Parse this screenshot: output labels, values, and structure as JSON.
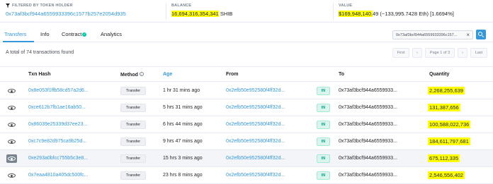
{
  "topbar": {
    "filter_label": "FILTERED BY TOKEN HOLDER",
    "filter_address": "0x73af3bcf944a6559933396c1577b257e2054d935",
    "balance_label": "BALANCE",
    "balance_amount": "16,694,316,354,341",
    "balance_token": "SHIB",
    "value_label": "VALUE",
    "value_usd": "$169,948,140.",
    "value_rest": "49 (~133,995.7428 Eth) [1.6694%]"
  },
  "tabs": [
    {
      "label": "Transfers"
    },
    {
      "label": "Info"
    },
    {
      "label": "Contract"
    },
    {
      "label": "Analytics"
    }
  ],
  "search": {
    "value": "0x73af3bcf944a6559933396c157...",
    "close": "×"
  },
  "summary": "A total of 74 transactions found",
  "pagination": {
    "first": "First",
    "prev": "‹",
    "page": "Page 1 of 3",
    "next": "›",
    "last": "Last"
  },
  "table": {
    "headers": {
      "txn_hash": "Txn Hash",
      "method": "Method",
      "age": "Age",
      "from": "From",
      "to": "To",
      "quantity": "Quantity"
    },
    "rows": [
      {
        "hash": "0x8e053f1ffb58cd57a2d6...",
        "method": "Transfer",
        "age": "1 hr 31 mins ago",
        "from": "0x2efb50e952580f4ff32d...",
        "dir": "IN",
        "to": "0x73af3bcf944a6559933...",
        "qty": "2,268,255,639"
      },
      {
        "hash": "0xce612b7fb1ae16ab50...",
        "method": "Transfer",
        "age": "5 hrs 31 mins ago",
        "from": "0x2efb50e952580f4ff32d...",
        "dir": "IN",
        "to": "0x73af3bcf944a6559933...",
        "qty": "131,387,656"
      },
      {
        "hash": "0x86039e25339d37ee23...",
        "method": "Transfer",
        "age": "6 hrs 44 mins ago",
        "from": "0x2efb50e952580f4ff32d...",
        "dir": "IN",
        "to": "0x73af3bcf944a6559933...",
        "qty": "100,588,022,736"
      },
      {
        "hash": "0xc7c9e82d975ca9b25d...",
        "method": "Transfer",
        "age": "9 hrs 47 mins ago",
        "from": "0x2efb50e952580f4ff32d...",
        "dir": "IN",
        "to": "0x73af3bcf944a6559933...",
        "qty": "184,611,797,681"
      },
      {
        "hash": "0xe293a0bfcc755b5c3e8...",
        "method": "Transfer",
        "age": "15 hrs 3 mins ago",
        "from": "0x2efb50e952580f4ff32d...",
        "dir": "IN",
        "to": "0x73af3bcf944a6559933...",
        "qty": "675,112,335"
      },
      {
        "hash": "0x7eaa4810a405dc500fc...",
        "method": "Transfer",
        "age": "23 hrs 8 mins ago",
        "from": "0x2efb50e952580f4ff32d...",
        "dir": "IN",
        "to": "0x73af3bcf944a6559933...",
        "qty": "2,546,556,402"
      }
    ]
  }
}
